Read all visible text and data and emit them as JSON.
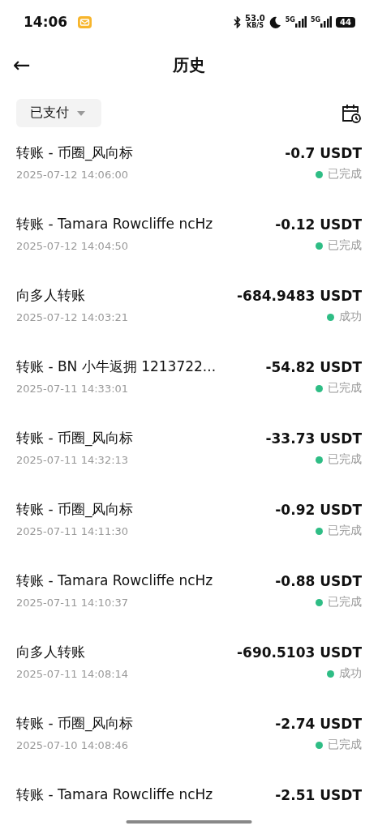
{
  "status_bar": {
    "time": "14:06",
    "speed": "53.0",
    "speed_unit": "KB/S",
    "network_1": "5G",
    "network_2": "5G",
    "battery": "44"
  },
  "header": {
    "back": "←",
    "title": "历史"
  },
  "filter": {
    "label": "已支付"
  },
  "transactions": [
    {
      "title": "转账 - 币圈_风向标",
      "amount": "-0.7 USDT",
      "time": "2025-07-12 14:06:00",
      "status": "已完成"
    },
    {
      "title": "转账 - Tamara Rowcliffe ncHz",
      "amount": "-0.12 USDT",
      "time": "2025-07-12 14:04:50",
      "status": "已完成"
    },
    {
      "title": "向多人转账",
      "amount": "-684.9483 USDT",
      "time": "2025-07-12 14:03:21",
      "status": "成功"
    },
    {
      "title": "转账 - BN 小牛返拥 1213722...",
      "amount": "-54.82 USDT",
      "time": "2025-07-11 14:33:01",
      "status": "已完成"
    },
    {
      "title": "转账 - 币圈_风向标",
      "amount": "-33.73 USDT",
      "time": "2025-07-11 14:32:13",
      "status": "已完成"
    },
    {
      "title": "转账 - 币圈_风向标",
      "amount": "-0.92 USDT",
      "time": "2025-07-11 14:11:30",
      "status": "已完成"
    },
    {
      "title": "转账 - Tamara Rowcliffe ncHz",
      "amount": "-0.88 USDT",
      "time": "2025-07-11 14:10:37",
      "status": "已完成"
    },
    {
      "title": "向多人转账",
      "amount": "-690.5103 USDT",
      "time": "2025-07-11 14:08:14",
      "status": "成功"
    },
    {
      "title": "转账 - 币圈_风向标",
      "amount": "-2.74 USDT",
      "time": "2025-07-10 14:08:46",
      "status": "已完成"
    },
    {
      "title": "转账 - Tamara Rowcliffe ncHz",
      "amount": "-2.51 USDT"
    }
  ]
}
